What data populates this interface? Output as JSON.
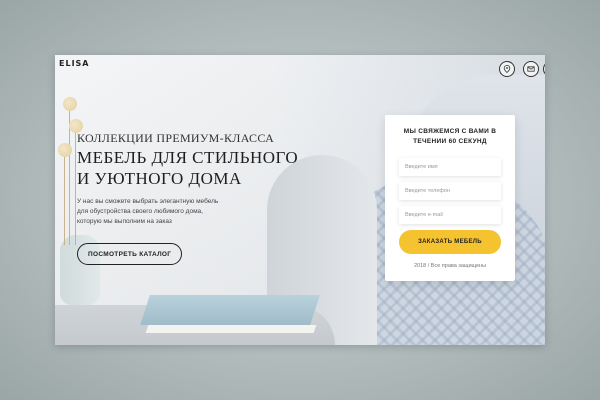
{
  "header": {
    "logo": "ELISA",
    "icons": [
      "map-pin-icon",
      "mail-icon",
      "phone-icon"
    ]
  },
  "hero": {
    "subtitle": "КОЛЛЕКЦИИ ПРЕМИУМ-КЛАССА",
    "title_line1": "МЕБЕЛЬ ДЛЯ СТИЛЬНОГО",
    "title_line2": "И УЮТНОГО ДОМА",
    "desc_line1": "У нас вы сможете выбрать элегантную мебель",
    "desc_line2": "для обустройства своего любимого дома,",
    "desc_line3": "которую мы выполним на заказ",
    "button_label": "ПОСМОТРЕТЬ КАТАЛОГ"
  },
  "form": {
    "title_line1": "МЫ СВЯЖЕМСЯ С ВАМИ В",
    "title_line2": "ТЕЧЕНИИ 60 СЕКУНД",
    "name_placeholder": "Введите имя",
    "phone_placeholder": "Введите телефон",
    "email_placeholder": "Введите e-mail",
    "submit_label": "ЗАКАЗАТЬ МЕБЕЛЬ",
    "copyright": "2018 / Все права защищены"
  },
  "colors": {
    "accent": "#f5c230",
    "text_dark": "#1e1e1e",
    "backdrop": "#b2bcbc"
  }
}
